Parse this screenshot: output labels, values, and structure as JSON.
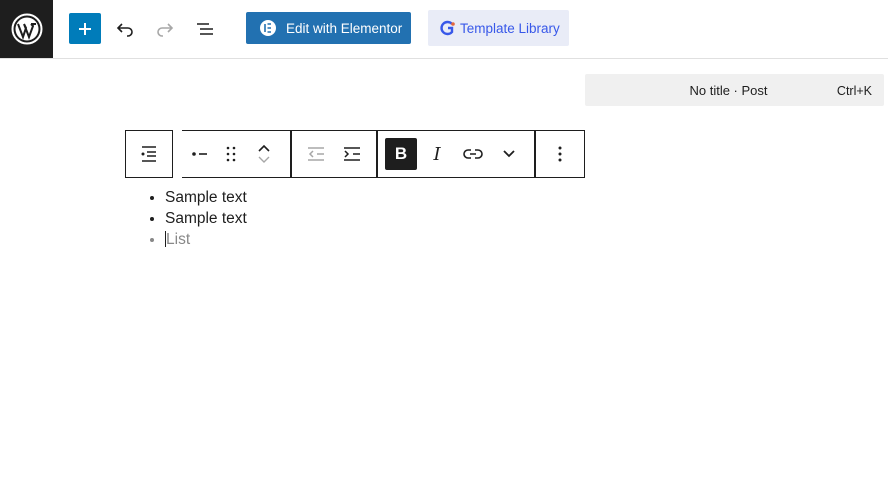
{
  "toolbar": {
    "add_block_label": "+",
    "edit_elementor_label": "Edit with Elementor",
    "template_library_label": "Template Library"
  },
  "command_bar": {
    "title": "No title · Post",
    "shortcut": "Ctrl+K"
  },
  "block_toolbar": {
    "bold_label": "B",
    "italic_label": "I"
  },
  "list": {
    "items": [
      "Sample text",
      "Sample text"
    ],
    "placeholder": "List"
  },
  "colors": {
    "accent": "#007cba",
    "elementor": "#2271b1",
    "template_library_bg": "#e9ecf7",
    "template_library_text": "#3858e9",
    "dark": "#1e1e1e"
  }
}
